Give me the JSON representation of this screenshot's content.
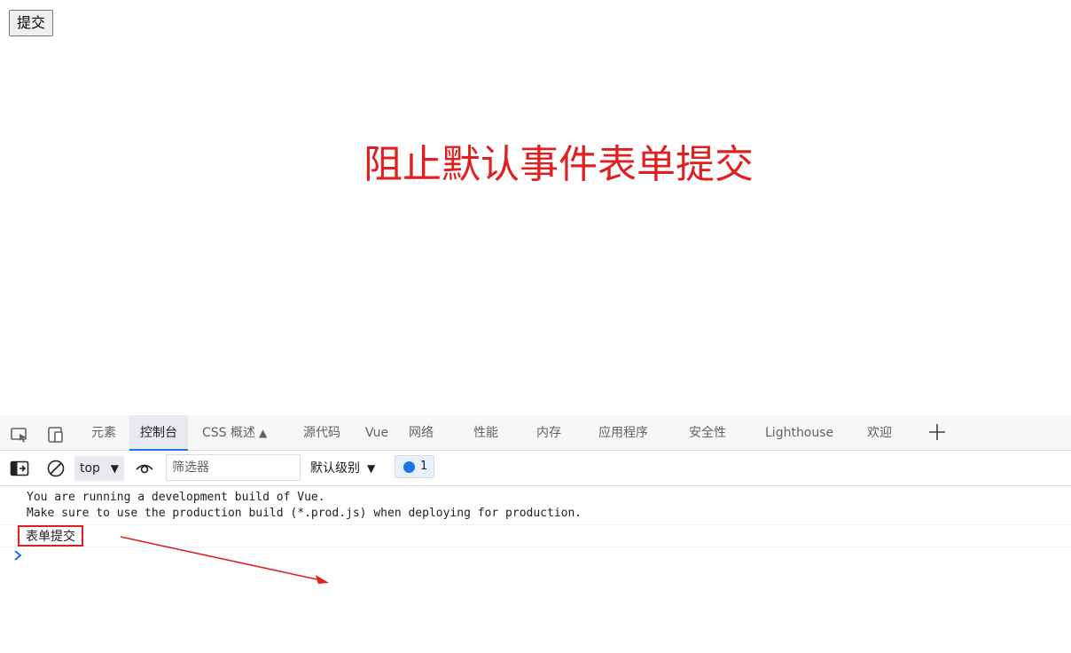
{
  "page": {
    "submit_button": "提交"
  },
  "devtools": {
    "tabs": [
      {
        "label": "元素",
        "active": false
      },
      {
        "label": "控制台",
        "active": true
      },
      {
        "label": "CSS 概述",
        "active": false
      },
      {
        "label": "源代码",
        "active": false
      },
      {
        "label": "Vue",
        "active": false
      },
      {
        "label": "网络",
        "active": false
      },
      {
        "label": "性能",
        "active": false
      },
      {
        "label": "内存",
        "active": false
      },
      {
        "label": "应用程序",
        "active": false
      },
      {
        "label": "安全性",
        "active": false
      },
      {
        "label": "Lighthouse",
        "active": false
      },
      {
        "label": "欢迎",
        "active": false
      }
    ],
    "toolbar": {
      "context": "top",
      "filter_placeholder": "筛选器",
      "levels": "默认级别",
      "issues_count": "1"
    },
    "console": {
      "vue_warning_line1": "You are running a development build of Vue.",
      "vue_warning_line2": "Make sure to use the production build (*.prod.js) when deploying for production.",
      "log_message": "表单提交"
    }
  },
  "annotation": {
    "text": "阻止默认事件表单提交",
    "color": "#e02020"
  },
  "colors": {
    "accent": "#1a73e8",
    "annotation": "#e02020"
  }
}
